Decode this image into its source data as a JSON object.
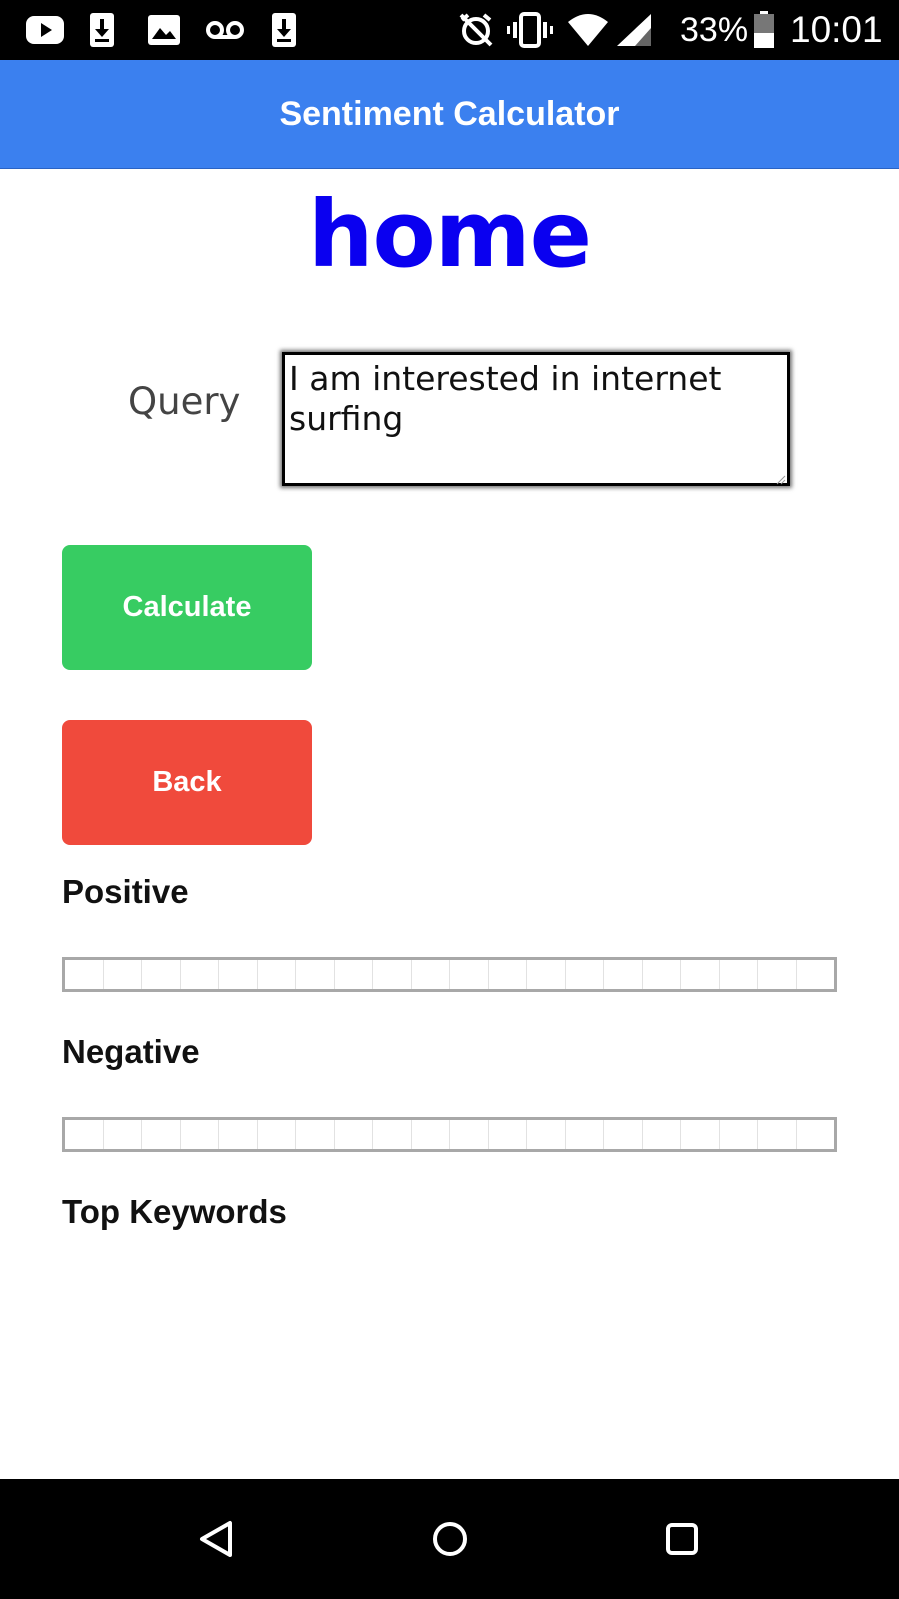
{
  "status_bar": {
    "icons": [
      "youtube-icon",
      "download-icon",
      "image-icon",
      "voicemail-icon",
      "download-icon",
      "alarm-off-icon",
      "vibrate-icon",
      "wifi-icon",
      "signal-icon",
      "battery-icon"
    ],
    "battery_percent": "33%",
    "time": "10:01"
  },
  "app_bar": {
    "title": "Sentiment Calculator",
    "color": "#3b80ef"
  },
  "page": {
    "heading": "home",
    "heading_color": "#0a00f0"
  },
  "form": {
    "query_label": "Query",
    "query_value": "I am interested in internet surfing"
  },
  "buttons": {
    "calculate_label": "Calculate",
    "calculate_color": "#37cc62",
    "back_label": "Back",
    "back_color": "#f04a3c"
  },
  "results": {
    "positive_label": "Positive",
    "positive_value": 0,
    "negative_label": "Negative",
    "negative_value": 0,
    "keywords_label": "Top Keywords",
    "keywords": []
  },
  "nav_bar": {
    "icons": [
      "back-icon",
      "home-icon",
      "recents-icon"
    ]
  }
}
